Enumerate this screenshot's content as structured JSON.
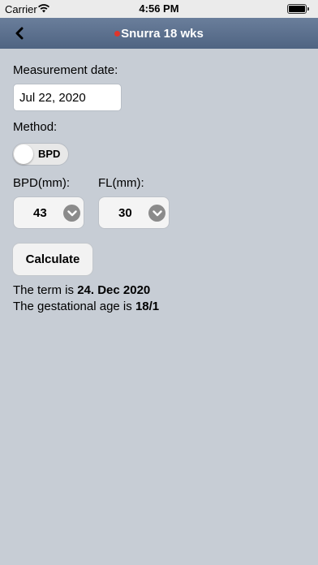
{
  "status_bar": {
    "carrier": "Carrier",
    "time": "4:56 PM"
  },
  "nav": {
    "title": "Snurra 18 wks"
  },
  "form": {
    "date_label": "Measurement date:",
    "date_value": "Jul 22, 2020",
    "method_label": "Method:",
    "method_toggle_label": "BPD",
    "bpd_label": "BPD(mm):",
    "bpd_value": "43",
    "fl_label": "FL(mm):",
    "fl_value": "30",
    "calculate_label": "Calculate"
  },
  "result": {
    "term_prefix": "The term is ",
    "term_value": "24. Dec 2020",
    "ga_prefix": "The gestational age is ",
    "ga_value": "18/1"
  }
}
